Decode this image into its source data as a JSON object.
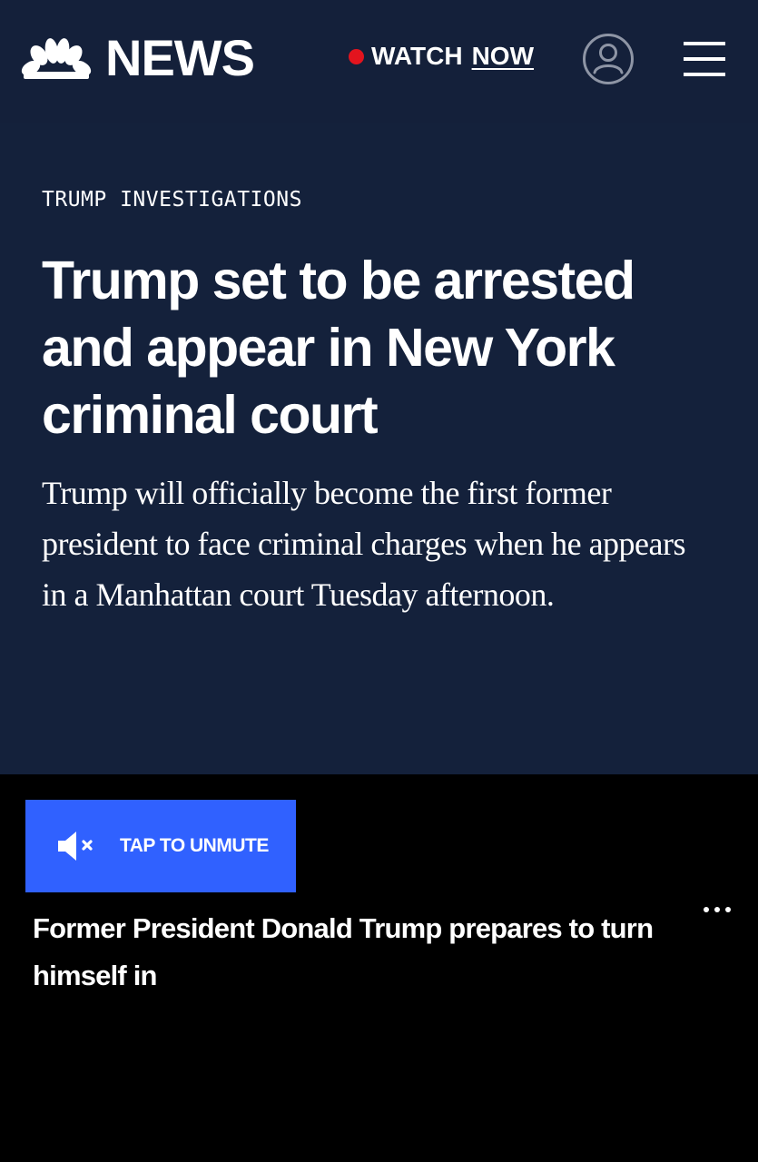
{
  "header": {
    "logo_text": "NEWS",
    "watch_label": "WATCH",
    "watch_now_label": "NOW"
  },
  "article": {
    "kicker": "TRUMP INVESTIGATIONS",
    "headline": "Trump set to be arrested and appear in New York criminal court",
    "dek": "Trump will officially become the first former president to face criminal charges when he appears in a Manhattan court Tuesday afternoon."
  },
  "video": {
    "unmute_label": "TAP TO UNMUTE",
    "title": "Former President Donald Trump prepares to turn himself in"
  },
  "icons": {
    "logo": "nbc-peacock-icon",
    "live": "live-dot-icon",
    "user": "user-icon",
    "menu": "hamburger-menu-icon",
    "mute": "muted-speaker-icon",
    "more": "more-options-icon"
  },
  "colors": {
    "header_bg": "#14203a",
    "article_bg": "#14213b",
    "video_bg": "#000000",
    "live_red": "#e3141e",
    "unmute_blue": "#3061ff"
  }
}
